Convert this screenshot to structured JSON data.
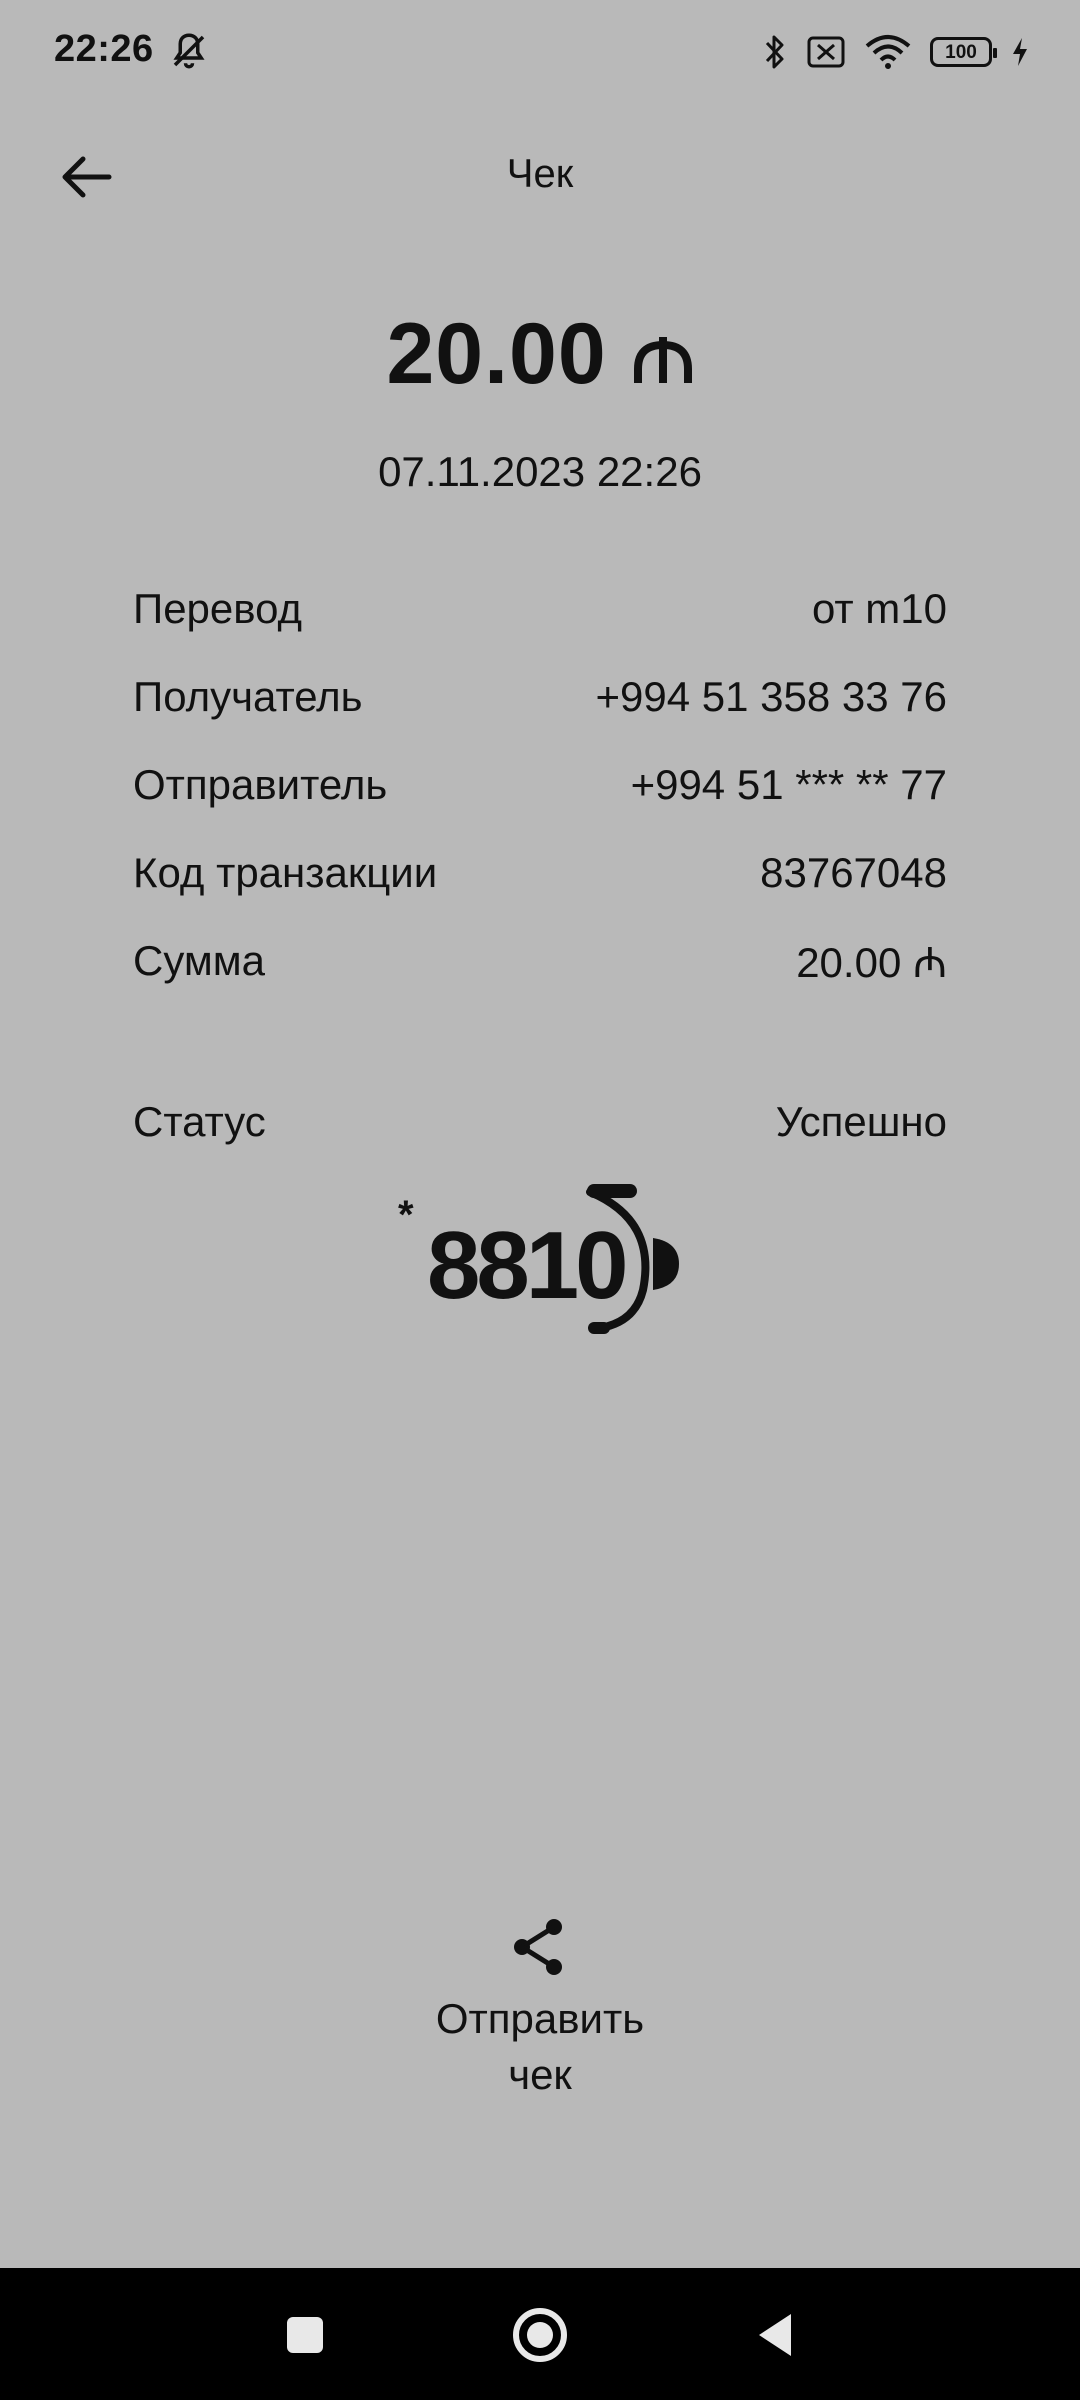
{
  "status_bar": {
    "time": "22:26",
    "battery": "100",
    "icons": [
      "mute-icon",
      "bluetooth-icon",
      "sim-off-icon",
      "wifi-icon",
      "battery-icon",
      "charging-icon"
    ]
  },
  "header": {
    "title": "Чек",
    "back_icon": "arrow-left-icon"
  },
  "receipt": {
    "amount": "20.00",
    "currency_symbol": "₼",
    "datetime": "07.11.2023 22:26",
    "rows": [
      {
        "label": "Перевод",
        "value": "от m10"
      },
      {
        "label": "Получатель",
        "value": "+994 51 358 33 76"
      },
      {
        "label": "Отправитель",
        "value": "+994 51 *** ** 77"
      },
      {
        "label": "Код транзакции",
        "value": "83767048"
      },
      {
        "label": "Сумма",
        "value": "20.00 ₼"
      }
    ],
    "status_label": "Статус",
    "status_value": "Успешно"
  },
  "logo": {
    "star": "*",
    "number": "8810"
  },
  "share": {
    "icon": "share-icon",
    "label_line1": "Отправить",
    "label_line2": "чек"
  },
  "nav": {
    "icons": [
      "recents-icon",
      "home-icon",
      "back-icon"
    ]
  }
}
